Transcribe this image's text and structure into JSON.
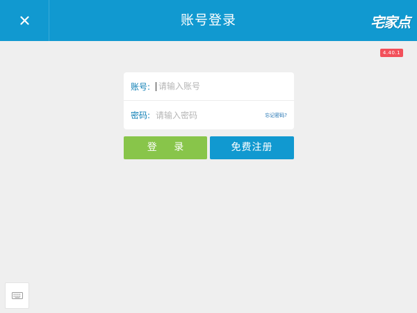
{
  "header": {
    "title": "账号登录",
    "logo_text": "宅家点",
    "background_color": "#1199d0"
  },
  "close_icon": "close-icon",
  "version_badge": "4.40.1",
  "form": {
    "account_label": "账号:",
    "account_placeholder": "请输入账号",
    "password_label": "密码:",
    "password_placeholder": "请输入密码",
    "forgot_link": "忘记密码?"
  },
  "buttons": {
    "login_label": "登 录",
    "login_color": "#88c54a",
    "register_label": "免费注册",
    "register_color": "#1199d0"
  },
  "keyboard_icon": "keyboard-icon"
}
